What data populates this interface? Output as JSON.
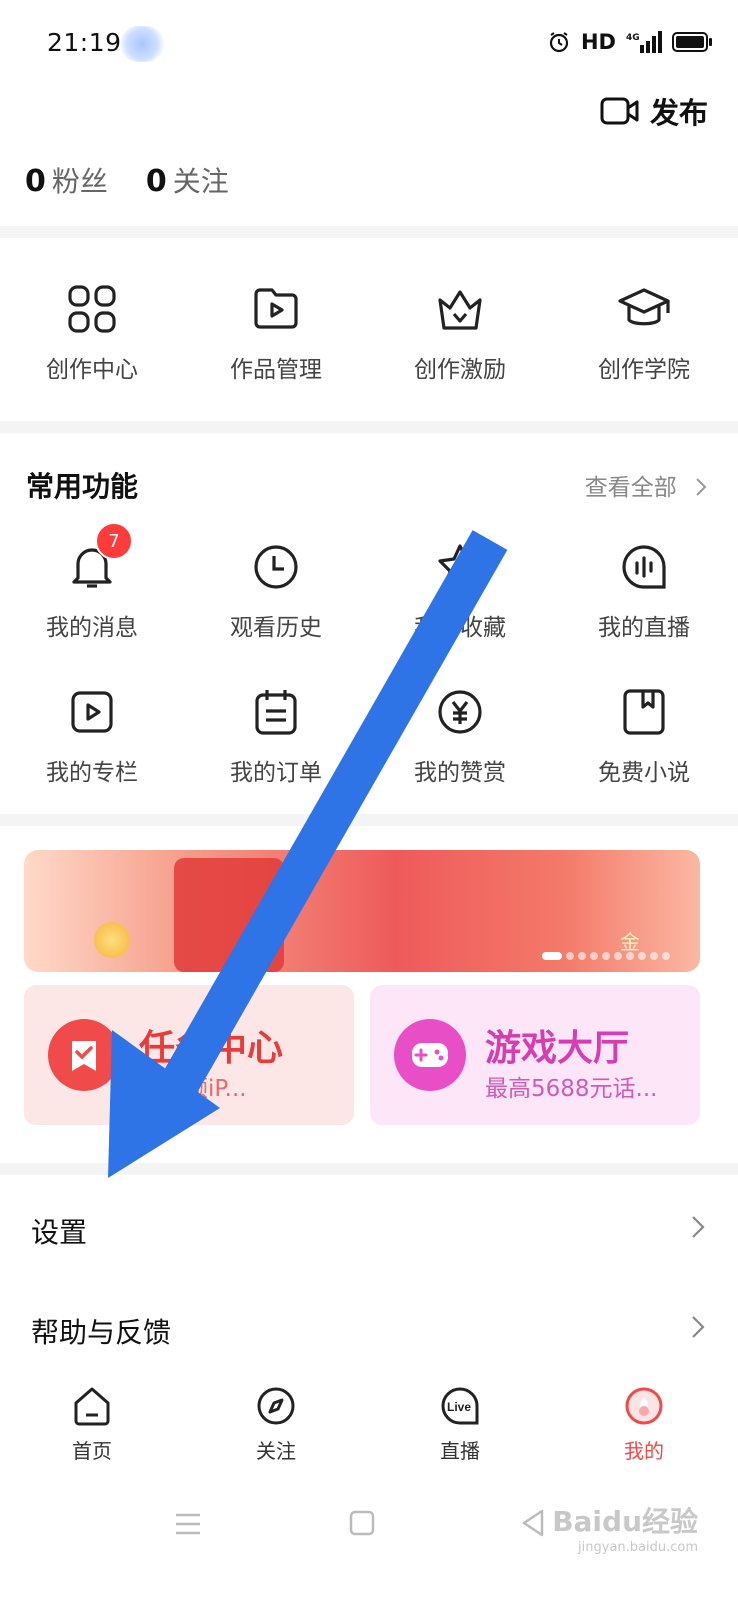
{
  "status": {
    "time": "21:19",
    "hd": "HD",
    "network": "4G"
  },
  "header": {
    "publish_label": "发布"
  },
  "profile": {
    "fans_count": "0",
    "fans_label": "粉丝",
    "follow_count": "0",
    "follow_label": "关注"
  },
  "creator": {
    "items": [
      {
        "label": "创作中心",
        "icon": "grid-icon"
      },
      {
        "label": "作品管理",
        "icon": "folder-play-icon"
      },
      {
        "label": "创作激励",
        "icon": "crown-icon"
      },
      {
        "label": "创作学院",
        "icon": "graduation-cap-icon"
      }
    ]
  },
  "common": {
    "title": "常用功能",
    "see_all": "查看全部",
    "items": [
      {
        "label": "我的消息",
        "icon": "bell-icon",
        "badge": "7"
      },
      {
        "label": "观看历史",
        "icon": "clock-icon"
      },
      {
        "label": "我的收藏",
        "icon": "star-icon"
      },
      {
        "label": "我的直播",
        "icon": "live-icon"
      },
      {
        "label": "我的专栏",
        "icon": "column-play-icon"
      },
      {
        "label": "我的订单",
        "icon": "order-icon"
      },
      {
        "label": "我的赞赏",
        "icon": "yen-icon"
      },
      {
        "label": "免费小说",
        "icon": "book-icon"
      }
    ]
  },
  "banner": {
    "text": "金"
  },
  "cards": {
    "task": {
      "title": "任务中心",
      "subtitle": "参与领iP...",
      "color": "#f04a4a"
    },
    "game": {
      "title": "游戏大厅",
      "subtitle": "最高5688元话...",
      "color": "#e84fc6"
    }
  },
  "menu": {
    "settings": "设置",
    "help": "帮助与反馈"
  },
  "tabs": [
    {
      "label": "首页",
      "icon": "home-icon"
    },
    {
      "label": "关注",
      "icon": "compass-icon"
    },
    {
      "label": "直播",
      "icon": "live-tab-icon"
    },
    {
      "label": "我的",
      "icon": "me-icon",
      "active": true
    }
  ],
  "watermark": {
    "text": "Baidu经验",
    "sub": "jingyan.baidu.com"
  },
  "colors": {
    "accent": "#f04a4a",
    "arrow": "#2f74e6"
  }
}
